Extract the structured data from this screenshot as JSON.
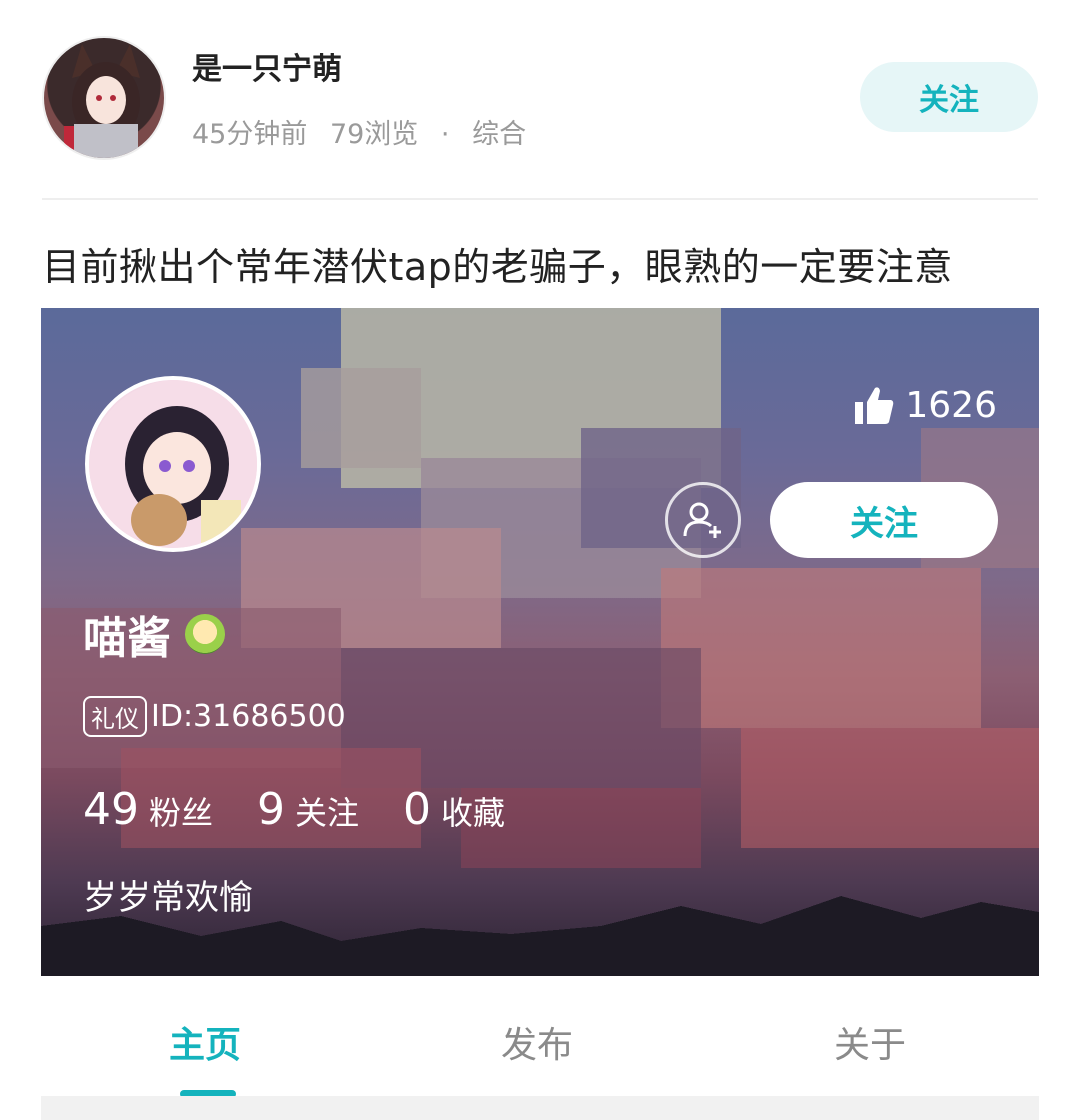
{
  "post": {
    "author_name": "是一只宁萌",
    "time_ago": "45分钟前",
    "views": "79浏览",
    "dot": "·",
    "category": "综合",
    "follow_label": "关注",
    "title": "目前揪出个常年潜伏tap的老骗子，眼熟的一定要注意"
  },
  "profile": {
    "likes": "1626",
    "follow_label": "关注",
    "nickname": "喵酱",
    "etiquette_tag": "礼仪",
    "id_text": "ID:31686500",
    "stats": [
      {
        "num": "49",
        "label": "粉丝"
      },
      {
        "num": "9",
        "label": "关注"
      },
      {
        "num": "0",
        "label": "收藏"
      }
    ],
    "bio": "岁岁常欢愉"
  },
  "tabs": [
    {
      "label": "主页"
    },
    {
      "label": "发布"
    },
    {
      "label": "关于"
    }
  ],
  "colors": {
    "accent": "#14b3bd",
    "accent_bg": "#e6f6f7"
  },
  "icons": {
    "likes": "thumbs-up-icon",
    "add_friend": "add-friend-icon"
  }
}
